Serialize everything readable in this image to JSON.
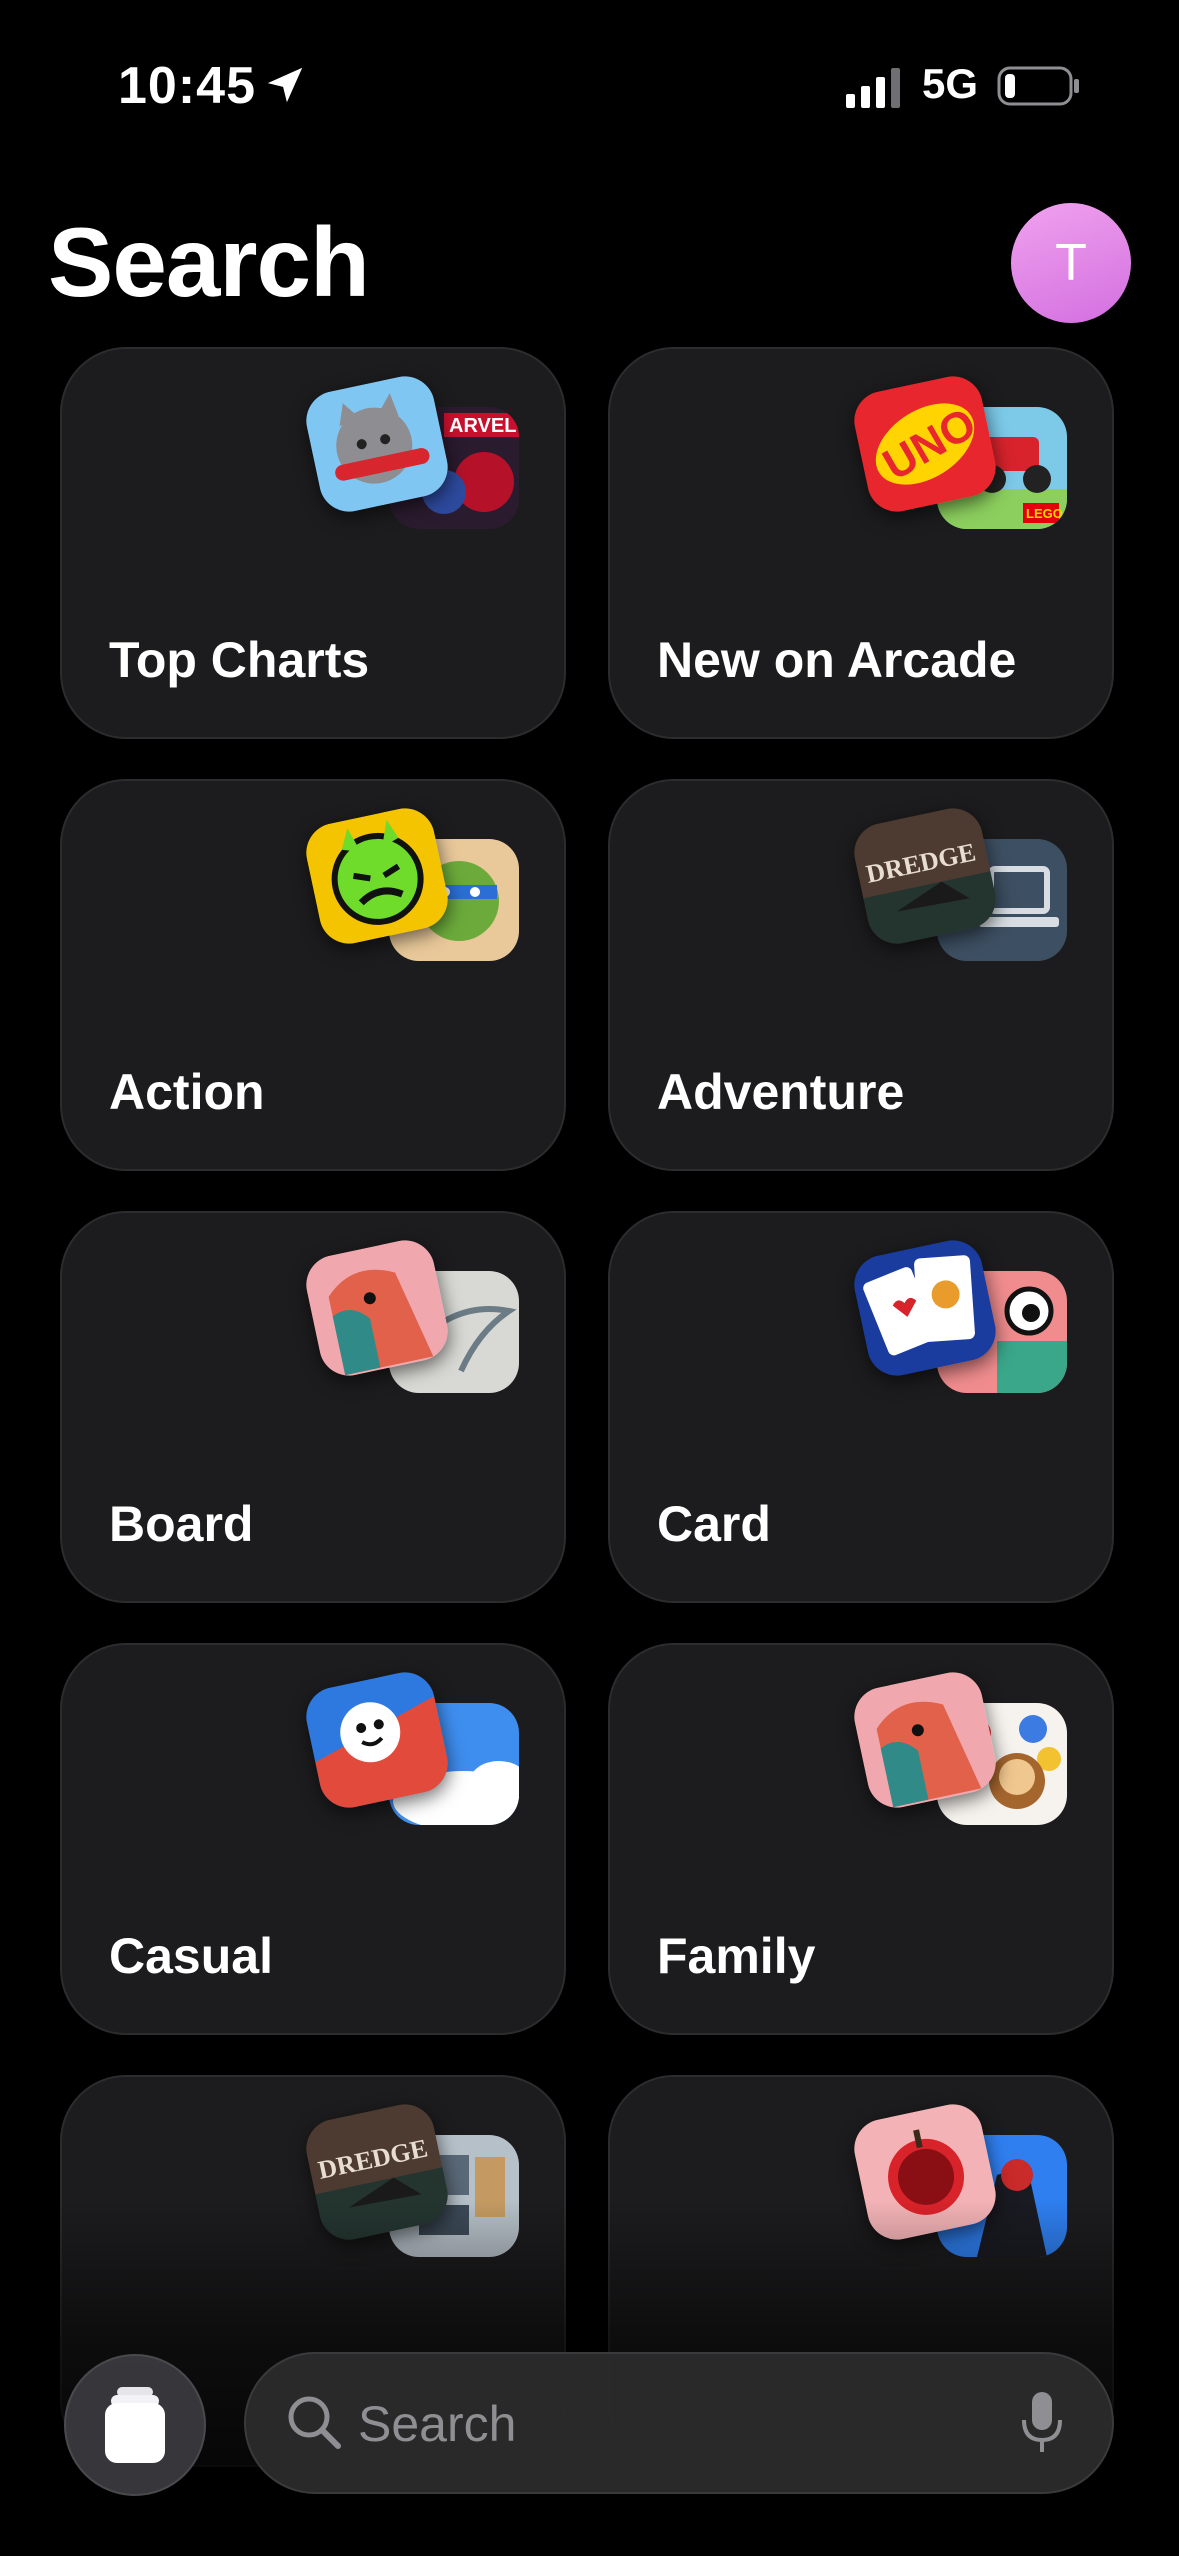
{
  "status_bar": {
    "time": "10:45",
    "network": "5G"
  },
  "header": {
    "title": "Search",
    "avatar_initial": "T"
  },
  "categories": [
    {
      "label": "Top Charts"
    },
    {
      "label": "New on Arcade"
    },
    {
      "label": "Action"
    },
    {
      "label": "Adventure"
    },
    {
      "label": "Board"
    },
    {
      "label": "Card"
    },
    {
      "label": "Casual"
    },
    {
      "label": "Family"
    },
    {
      "label": ""
    },
    {
      "label": ""
    }
  ],
  "artwork_text": {
    "marvel": "ARVEL",
    "uno": "UNO",
    "lego": "LEGO",
    "dredge": "DREDGE"
  },
  "bottom_bar": {
    "search_placeholder": "Search"
  },
  "colors": {
    "background": "#000000",
    "tile": "#1c1c1e",
    "avatar": "#e08ae8"
  }
}
